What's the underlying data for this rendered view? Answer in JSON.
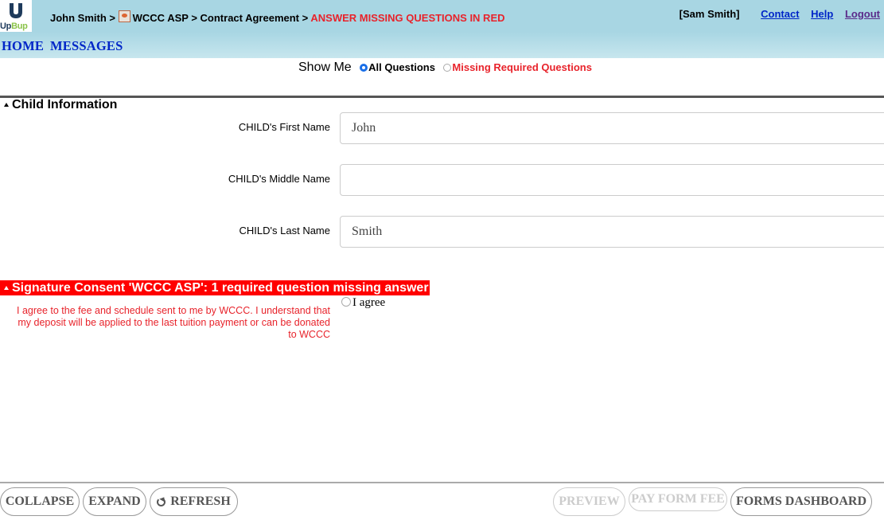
{
  "header": {
    "logo_text_1": "Up",
    "logo_text_2": "Bup",
    "breadcrumb": {
      "user": "John Smith",
      "sep1": ">",
      "organization": "WCCC ASP",
      "sep2": ">",
      "form": "Contract Agreement",
      "sep3": ">",
      "warning": "ANSWER MISSING QUESTIONS IN RED"
    },
    "account": {
      "user_label": "[Sam Smith]",
      "contact": "Contact",
      "help": "Help",
      "logout": "Logout"
    }
  },
  "menu": {
    "home": "HOME",
    "messages": "MESSAGES"
  },
  "filter": {
    "label": "Show Me",
    "option_all": "All Questions",
    "option_missing": "Missing Required Questions",
    "selected": "All Questions"
  },
  "child_section": {
    "title": "Child Information",
    "fields": [
      {
        "label": "CHILD's First Name",
        "value": "John"
      },
      {
        "label": "CHILD's Middle Name",
        "value": ""
      },
      {
        "label": "CHILD's Last Name",
        "value": "Smith"
      }
    ]
  },
  "signature_section": {
    "title": "Signature Consent 'WCCC ASP': 1 required question missing answer",
    "question": "I agree to the fee and schedule sent to me by WCCC. I understand that my deposit will be applied to the last tuition payment or can be donated to WCCC",
    "option": "I agree"
  },
  "footer": {
    "collapse": "COLLAPSE",
    "expand": "EXPAND",
    "refresh": "REFRESH",
    "preview": "PREVIEW",
    "pay_form_fee": "PAY FORM FEE",
    "forms_dashboard": "FORMS DASHBOARD"
  },
  "colors": {
    "header_bg": "#a8d6e3",
    "link_blue": "#0026c8",
    "warning_red": "#e8232b",
    "section_red": "#ff0000"
  }
}
